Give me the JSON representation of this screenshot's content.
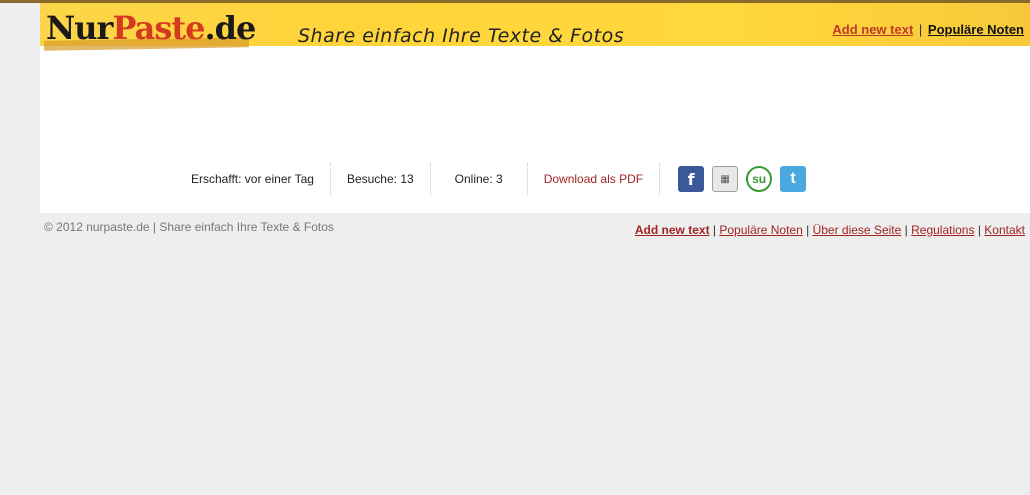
{
  "header": {
    "logo_nur": "Nur",
    "logo_paste": "Paste",
    "logo_de": ".de",
    "tagline": "Share einfach Ihre Texte & Fotos",
    "nav": {
      "add_new_text": "Add new text",
      "separator": "|",
      "popular_notes": "Populäre Noten"
    }
  },
  "stats": {
    "created": "Erschafft: vor einer Tag",
    "visits": "Besuche: 13",
    "online": "Online: 3",
    "download_pdf": "Download als PDF",
    "social_icons": [
      "facebook-icon",
      "digg-icon",
      "stumbleupon-icon",
      "twitter-icon"
    ]
  },
  "footer": {
    "copyright": "© 2012 nurpaste.de | Share einfach Ihre Texte & Fotos",
    "nav": {
      "add_new_text": "Add new text",
      "popular_notes": "Populäre Noten",
      "about": "Über diese Seite",
      "regulations": "Regulations",
      "contact": "Kontakt",
      "separator": "|"
    }
  },
  "colors": {
    "header_yellow": "#ffd43a",
    "link_red": "#a02424",
    "page_bg": "#eeeeee"
  }
}
